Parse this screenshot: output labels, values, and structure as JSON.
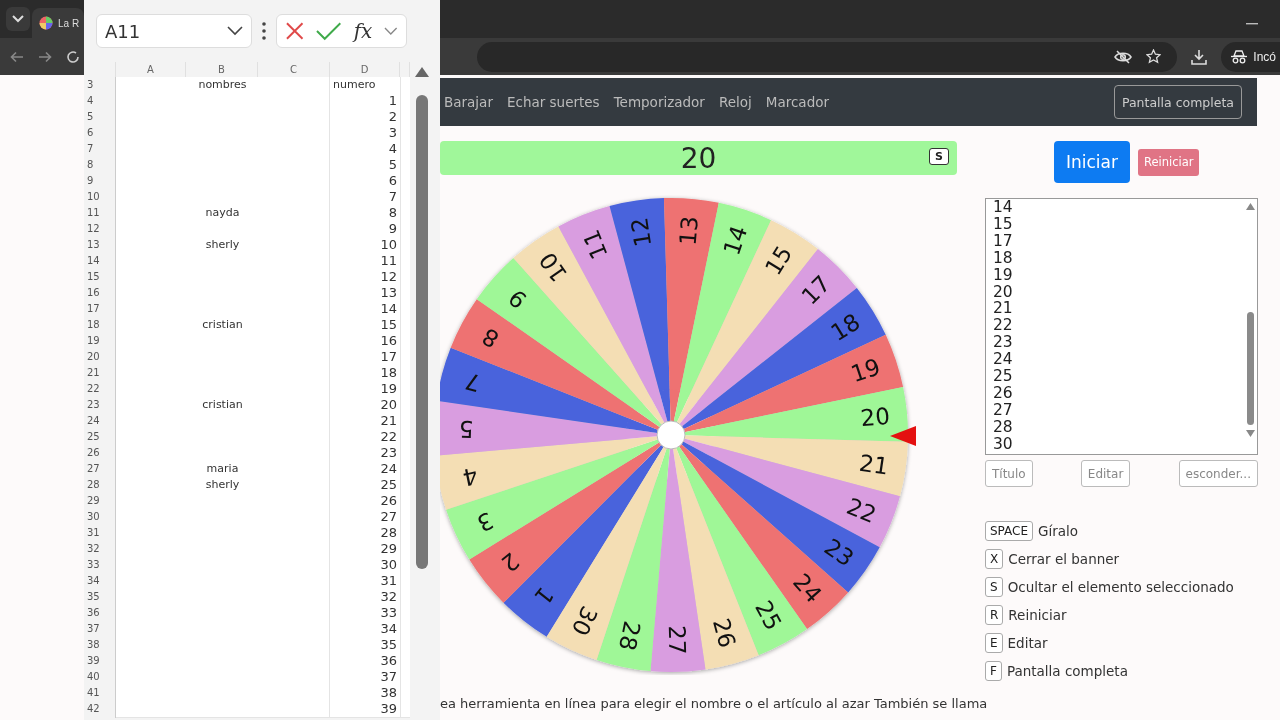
{
  "browser": {
    "tab_title": "La R",
    "incognito_label": "Incó"
  },
  "spreadsheet": {
    "name_box": "A11",
    "formula_label": "fx",
    "columns": [
      "A",
      "B",
      "C",
      "D"
    ],
    "rows": [
      {
        "row": "3",
        "kind": "header",
        "name": "nombres",
        "number": "numero"
      },
      {
        "row": "4",
        "kind": "data",
        "number": "1"
      },
      {
        "row": "5",
        "kind": "data",
        "number": "2"
      },
      {
        "row": "6",
        "kind": "data",
        "number": "3"
      },
      {
        "row": "7",
        "kind": "data",
        "number": "4"
      },
      {
        "row": "8",
        "kind": "data",
        "number": "5"
      },
      {
        "row": "9",
        "kind": "data",
        "number": "6"
      },
      {
        "row": "10",
        "kind": "data",
        "number": "7"
      },
      {
        "row": "11",
        "kind": "data",
        "name": "nayda",
        "number": "8"
      },
      {
        "row": "12",
        "kind": "data",
        "number": "9"
      },
      {
        "row": "13",
        "kind": "data",
        "name": "sherly",
        "number": "10"
      },
      {
        "row": "14",
        "kind": "data",
        "number": "11"
      },
      {
        "row": "15",
        "kind": "data",
        "number": "12"
      },
      {
        "row": "16",
        "kind": "data",
        "number": "13"
      },
      {
        "row": "17",
        "kind": "data",
        "number": "14"
      },
      {
        "row": "18",
        "kind": "data",
        "name": "cristian",
        "number": "15"
      },
      {
        "row": "19",
        "kind": "data",
        "number": "16"
      },
      {
        "row": "20",
        "kind": "data",
        "number": "17"
      },
      {
        "row": "21",
        "kind": "data",
        "number": "18"
      },
      {
        "row": "22",
        "kind": "data",
        "number": "19"
      },
      {
        "row": "23",
        "kind": "data",
        "name": "cristian",
        "number": "20"
      },
      {
        "row": "24",
        "kind": "data",
        "number": "21"
      },
      {
        "row": "25",
        "kind": "data",
        "number": "22"
      },
      {
        "row": "26",
        "kind": "data",
        "number": "23"
      },
      {
        "row": "27",
        "kind": "data",
        "name": "maria",
        "number": "24"
      },
      {
        "row": "28",
        "kind": "data",
        "name": "sherly",
        "number": "25"
      },
      {
        "row": "29",
        "kind": "data",
        "number": "26"
      },
      {
        "row": "30",
        "kind": "data",
        "number": "27"
      },
      {
        "row": "31",
        "kind": "data",
        "number": "28"
      },
      {
        "row": "32",
        "kind": "data",
        "number": "29"
      },
      {
        "row": "33",
        "kind": "data",
        "number": "30"
      },
      {
        "row": "34",
        "kind": "data",
        "number": "31"
      },
      {
        "row": "35",
        "kind": "data",
        "number": "32"
      },
      {
        "row": "36",
        "kind": "data",
        "number": "33"
      },
      {
        "row": "37",
        "kind": "data",
        "number": "34"
      },
      {
        "row": "38",
        "kind": "data",
        "number": "35"
      },
      {
        "row": "39",
        "kind": "data",
        "number": "36"
      },
      {
        "row": "40",
        "kind": "data",
        "number": "37"
      },
      {
        "row": "41",
        "kind": "data",
        "number": "38"
      },
      {
        "row": "42",
        "kind": "data",
        "number": "39"
      }
    ]
  },
  "nav": {
    "links": [
      "Barajar",
      "Echar suertes",
      "Temporizador",
      "Reloj",
      "Marcador"
    ],
    "fullscreen_button": "Pantalla completa"
  },
  "banner": {
    "result": "20",
    "key": "S"
  },
  "wheel": {
    "segments": [
      {
        "label": "1",
        "color": "#4a63dc"
      },
      {
        "label": "2",
        "color": "#ee7272"
      },
      {
        "label": "3",
        "color": "#9ff797"
      },
      {
        "label": "4",
        "color": "#f4deb4"
      },
      {
        "label": "5",
        "color": "#d99de0"
      },
      {
        "label": "7",
        "color": "#4a63dc"
      },
      {
        "label": "8",
        "color": "#ee7272"
      },
      {
        "label": "9",
        "color": "#9ff797"
      },
      {
        "label": "10",
        "color": "#f4deb4"
      },
      {
        "label": "11",
        "color": "#d99de0"
      },
      {
        "label": "12",
        "color": "#4a63dc"
      },
      {
        "label": "13",
        "color": "#ee7272"
      },
      {
        "label": "14",
        "color": "#9ff797"
      },
      {
        "label": "15",
        "color": "#f4deb4"
      },
      {
        "label": "17",
        "color": "#d99de0"
      },
      {
        "label": "18",
        "color": "#4a63dc"
      },
      {
        "label": "19",
        "color": "#ee7272"
      },
      {
        "label": "20",
        "color": "#9ff797"
      },
      {
        "label": "21",
        "color": "#f4deb4"
      },
      {
        "label": "22",
        "color": "#d99de0"
      },
      {
        "label": "23",
        "color": "#4a63dc"
      },
      {
        "label": "24",
        "color": "#ee7272"
      },
      {
        "label": "25",
        "color": "#9ff797"
      },
      {
        "label": "26",
        "color": "#f4deb4"
      },
      {
        "label": "27",
        "color": "#d99de0"
      },
      {
        "label": "28",
        "color": "#9ff797"
      },
      {
        "label": "30",
        "color": "#f4deb4"
      }
    ]
  },
  "controls": {
    "start_button": "Iniciar",
    "reset_button": "Reiniciar"
  },
  "names_list": [
    "14",
    "15",
    "17",
    "18",
    "19",
    "20",
    "21",
    "22",
    "23",
    "24",
    "25",
    "26",
    "27",
    "28",
    "30"
  ],
  "list_buttons": [
    "Título",
    "Editar",
    "esconder..."
  ],
  "shortcuts": [
    {
      "key": "SPACE",
      "label": "Gíralo"
    },
    {
      "key": "X",
      "label": "Cerrar el banner"
    },
    {
      "key": "S",
      "label": "Ocultar el elemento seleccionado"
    },
    {
      "key": "R",
      "label": "Reiniciar"
    },
    {
      "key": "E",
      "label": "Editar"
    },
    {
      "key": "F",
      "label": "Pantalla completa"
    }
  ],
  "footer_text": "ea herramienta en línea para elegir el nombre o el artículo al azar También se llama"
}
